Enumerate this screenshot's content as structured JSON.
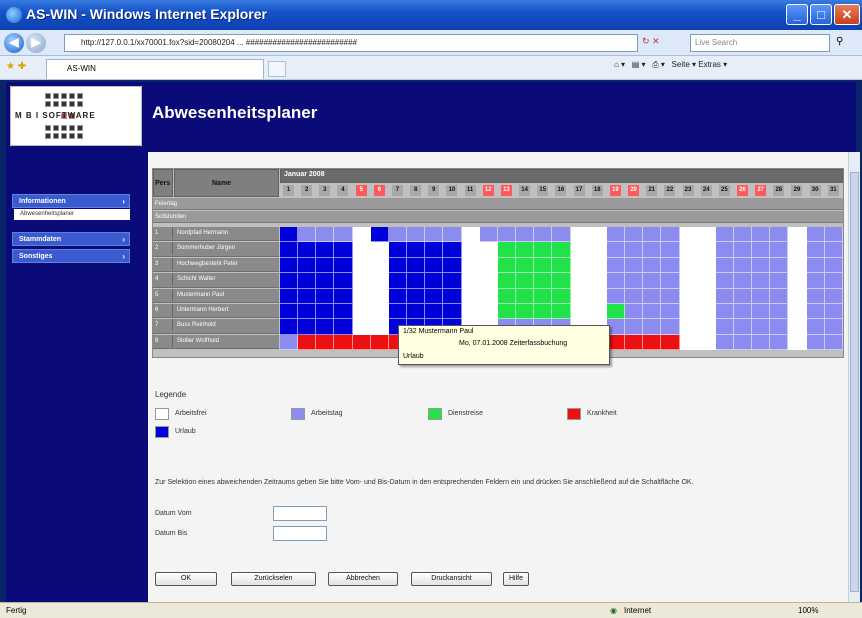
{
  "window": {
    "title": "AS-WIN - Windows Internet Explorer",
    "min": "_",
    "max": "□",
    "close": "✕"
  },
  "address": {
    "url": "http://127.0.0.1/xx70001.fox?sid=20080204 ... #########################",
    "search_placeholder": "Live Search"
  },
  "tab": {
    "label": "AS-WIN"
  },
  "toolbar_right": "Seite ▾   Extras ▾",
  "app": {
    "title": "Abwesenheitsplaner",
    "logo_text": "M B I  SOFTWARE"
  },
  "sidebar": {
    "items": [
      {
        "label": "Informationen"
      },
      {
        "label": "Abwesenheitsplaner"
      },
      {
        "label": "Stammdaten"
      },
      {
        "label": "Sonstiges"
      }
    ]
  },
  "grid": {
    "col_no": "Pers",
    "col_name": "Name",
    "month": "Januar 2008",
    "days": [
      "1",
      "2",
      "3",
      "4",
      "5",
      "6",
      "7",
      "8",
      "9",
      "10",
      "11",
      "12",
      "13",
      "14",
      "15",
      "16",
      "17",
      "18",
      "19",
      "20",
      "21",
      "22",
      "23",
      "24",
      "25",
      "26",
      "27",
      "28",
      "29",
      "30",
      "31"
    ],
    "weekend_days": [
      5,
      6,
      12,
      13,
      19,
      20,
      26,
      27
    ],
    "meta_rows": [
      "Feiertag",
      "Sollstunden"
    ],
    "people": [
      {
        "no": "1",
        "name": "Nordpfad Hermann",
        "days": "UAAAwUAAAAwAAAAAwwAAAAwwAAAAwAA"
      },
      {
        "no": "2",
        "name": "Sommerhuber Jürgen",
        "days": "UUUUwwUUUUwwDDDDwwAAAAwwAAAAwAA"
      },
      {
        "no": "3",
        "name": "Hochwegbesteht Peter",
        "days": "UUUUwwUUUUwwDDDDwwAAAAwwAAAAwAA"
      },
      {
        "no": "4",
        "name": "Schicht Walter",
        "days": "UUUUwwUUUUwwDDDDwwAAAAwwAAAAwAA"
      },
      {
        "no": "5",
        "name": "Mustermann Paul",
        "days": "UUUUwwUUUUwwDDDDwwAAAAwwAAAAwAA"
      },
      {
        "no": "6",
        "name": "Untermann Herbert",
        "days": "UUUUwwUUUUwwDDDDwwDAAAwwAAAAwAA"
      },
      {
        "no": "7",
        "name": "Buss Reinhold",
        "days": "UUUUwwUUUUwwAAAAwwAAAAwwAAAAwAA"
      },
      {
        "no": "8",
        "name": "Stoller Wolfhold",
        "days": "AKKKKKKKKKKKKKKKKKKKKKwwAAAAwAA"
      }
    ]
  },
  "tooltip": {
    "line1": "1/32 Mustermann Paul",
    "line2": "Mo, 07.01.2008 Zeiterfassbuchung",
    "line3": "Urlaub"
  },
  "legend": {
    "title": "Legende",
    "items": [
      {
        "label": "Arbeitsfrei",
        "color": "#ffffff"
      },
      {
        "label": "Arbeitstag",
        "color": "#8c8cf0"
      },
      {
        "label": "Dienstreise",
        "color": "#22e24a"
      },
      {
        "label": "Krankheit",
        "color": "#ee1010"
      },
      {
        "label": "Urlaub",
        "color": "#0000d8"
      }
    ]
  },
  "help": {
    "text": "Zur Selektion eines abweichenden Zeitraums geben Sie bitte Vom- und Bis-Datum in den entsprechenden Feldern ein und drücken Sie anschließend auf die Schaltfläche OK."
  },
  "form": {
    "from_label": "Datum Vom",
    "to_label": "Datum Bis",
    "from_value": "",
    "to_value": ""
  },
  "buttons": {
    "ok": "OK",
    "back": "Zurückselen",
    "cancel": "Abbrechen",
    "print": "Druckansicht",
    "help": "Hilfe"
  },
  "status": {
    "left": "Fertig",
    "zone": "Internet",
    "zoom": "100%"
  }
}
